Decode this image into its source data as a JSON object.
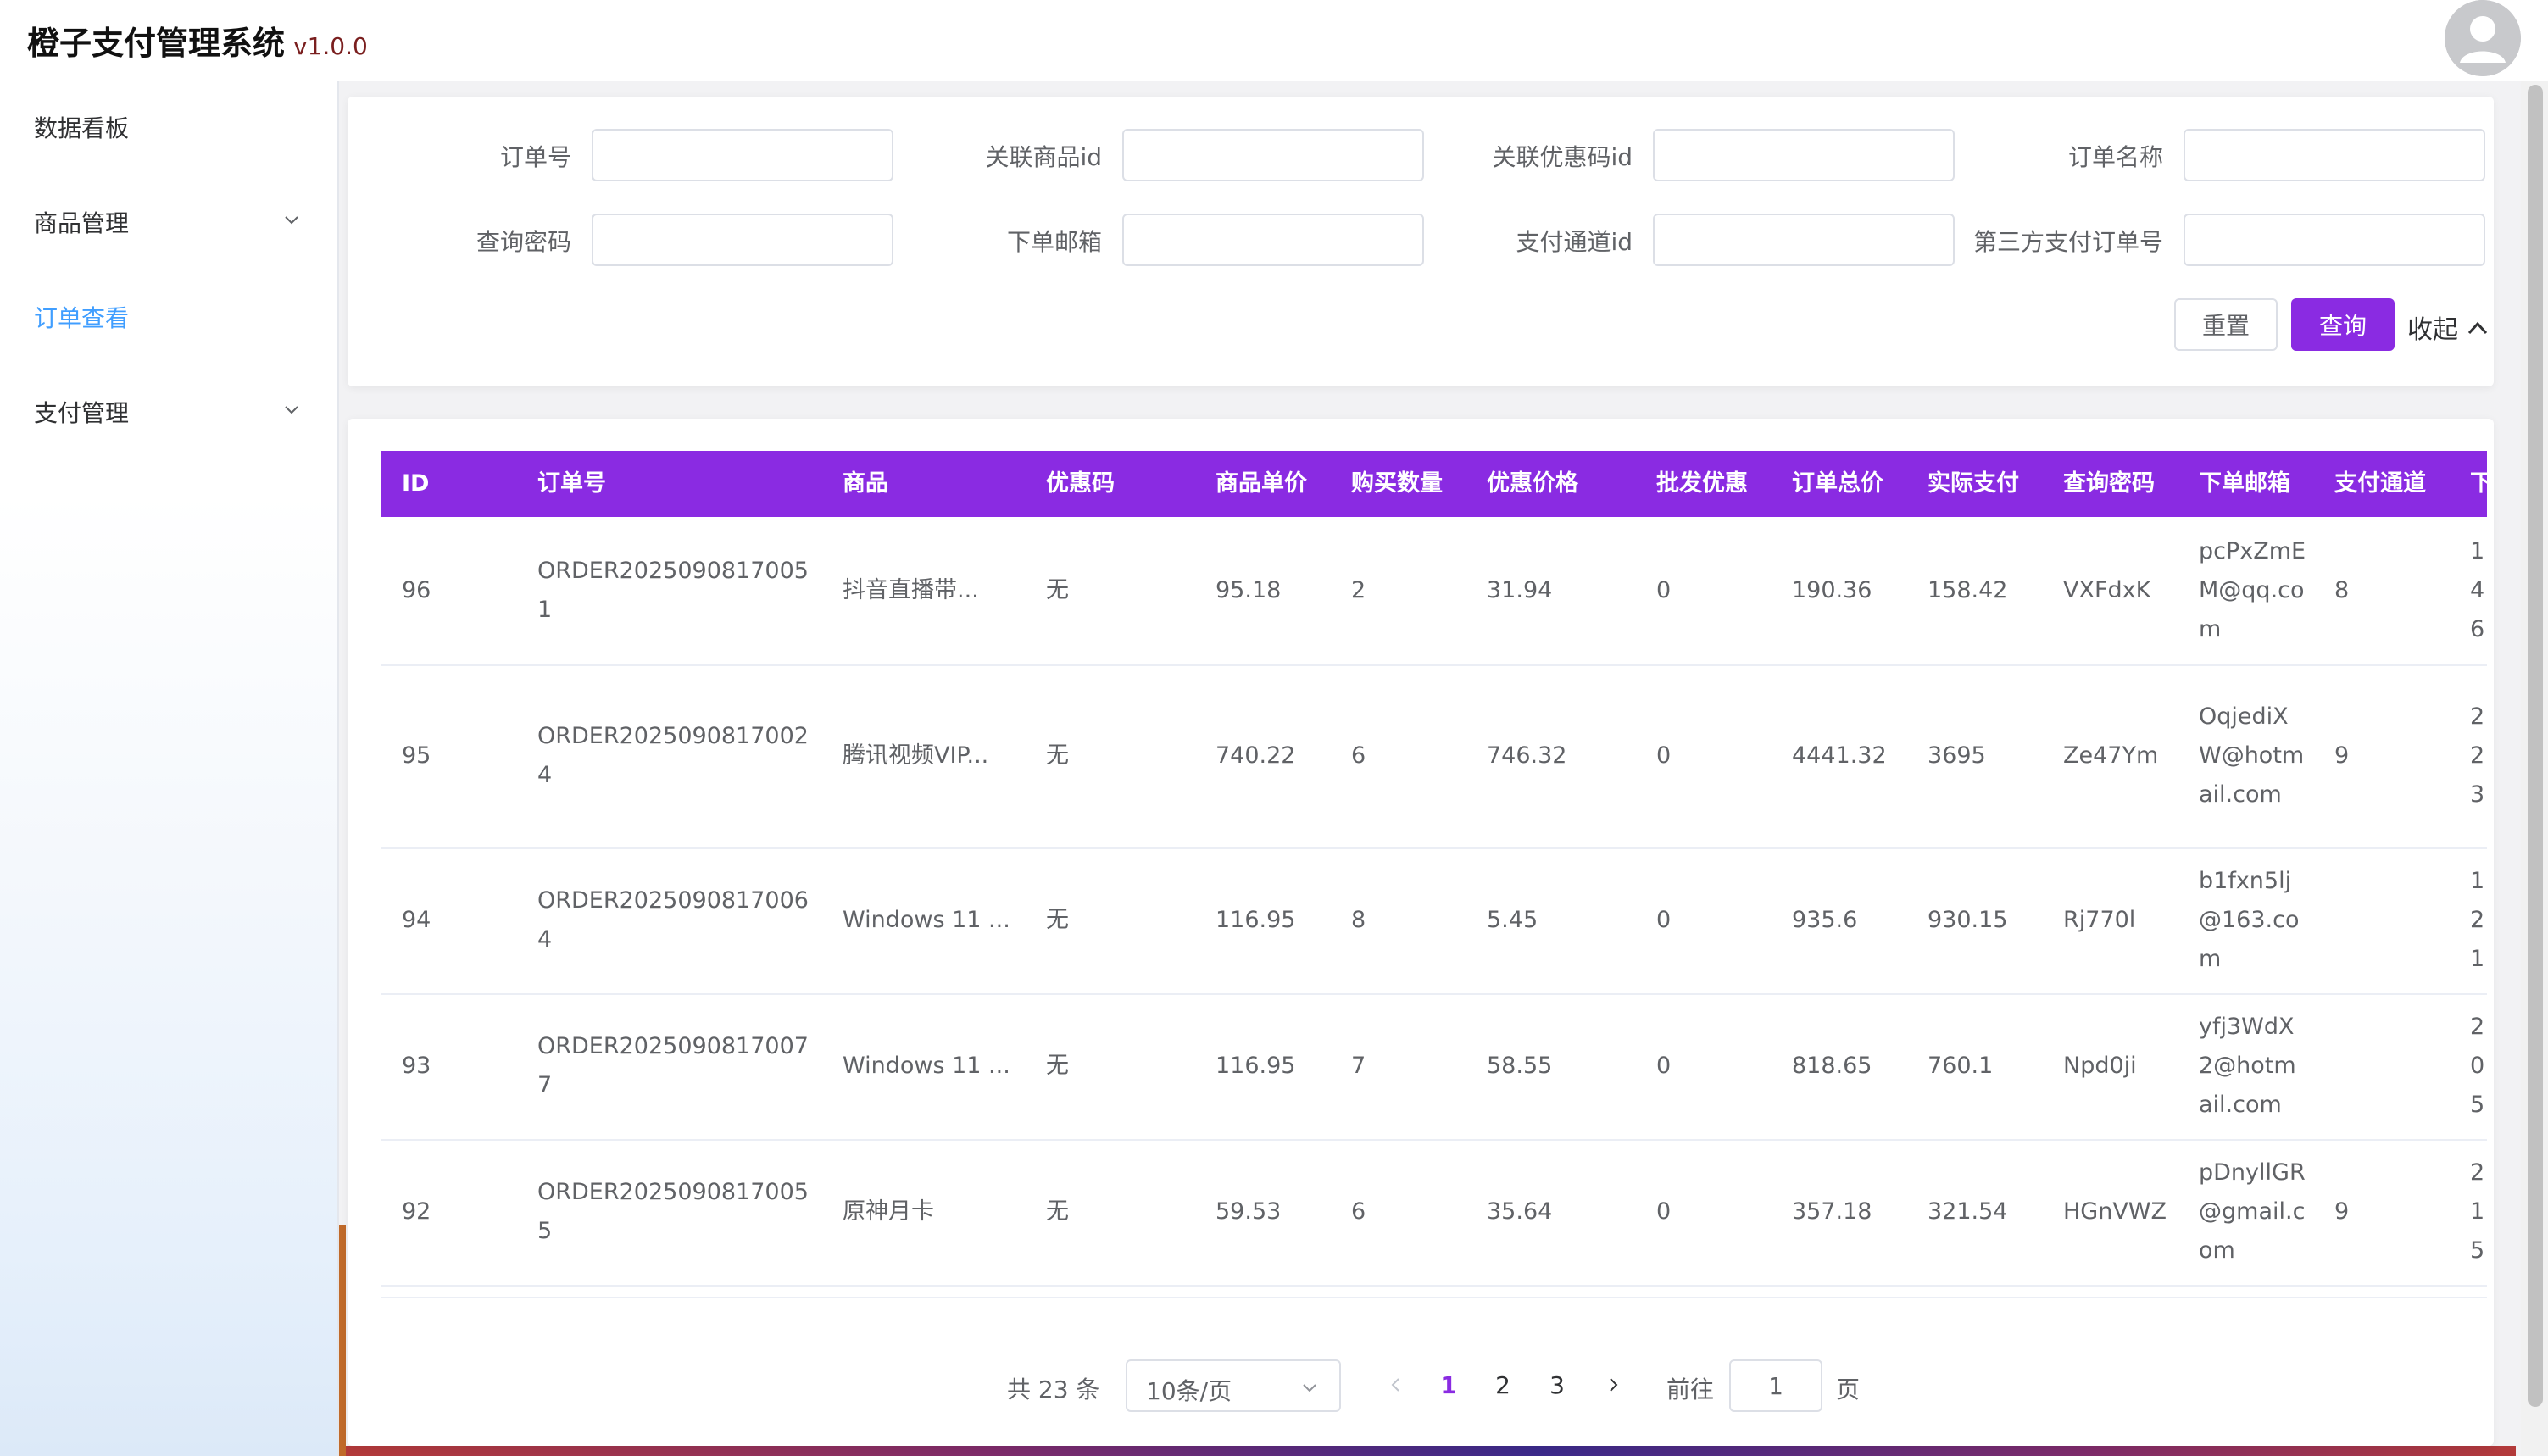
{
  "app": {
    "title": "橙子支付管理系统",
    "version": "v1.0.0"
  },
  "sidebar": {
    "items": [
      {
        "label": "数据看板",
        "has_children": false,
        "active": false
      },
      {
        "label": "商品管理",
        "has_children": true,
        "active": false
      },
      {
        "label": "订单查看",
        "has_children": false,
        "active": true
      },
      {
        "label": "支付管理",
        "has_children": true,
        "active": false
      }
    ]
  },
  "search": {
    "fields": [
      {
        "label": "订单号",
        "value": ""
      },
      {
        "label": "关联商品id",
        "value": ""
      },
      {
        "label": "关联优惠码id",
        "value": ""
      },
      {
        "label": "订单名称",
        "value": ""
      },
      {
        "label": "查询密码",
        "value": ""
      },
      {
        "label": "下单邮箱",
        "value": ""
      },
      {
        "label": "支付通道id",
        "value": ""
      },
      {
        "label": "第三方支付订单号",
        "value": ""
      }
    ],
    "reset_label": "重置",
    "query_label": "查询",
    "collapse_label": "收起"
  },
  "table": {
    "columns": [
      "ID",
      "订单号",
      "商品",
      "优惠码",
      "商品单价",
      "购买数量",
      "优惠价格",
      "批发优惠",
      "订单总价",
      "实际支付",
      "查询密码",
      "下单邮箱",
      "支付通道",
      "下"
    ],
    "rows": [
      {
        "id": "96",
        "order_no": "ORDER20250908170051",
        "product": "抖音直播带...",
        "coupon": "无",
        "unit_price": "95.18",
        "quantity": "2",
        "discount": "31.94",
        "bulk": "0",
        "total": "190.36",
        "paid": "158.42",
        "password": "VXFdxK",
        "email": "pcPxZmEM@qq.com",
        "channel": "8",
        "clipped": "146"
      },
      {
        "id": "95",
        "order_no": "ORDER20250908170024",
        "product": "腾讯视频VIP...",
        "coupon": "无",
        "unit_price": "740.22",
        "quantity": "6",
        "discount": "746.32",
        "bulk": "0",
        "total": "4441.32",
        "paid": "3695",
        "password": "Ze47Ym",
        "email": "OqjediXW@hotmail.com",
        "channel": "9",
        "clipped": "223"
      },
      {
        "id": "94",
        "order_no": "ORDER20250908170064",
        "product": "Windows 11 ...",
        "coupon": "无",
        "unit_price": "116.95",
        "quantity": "8",
        "discount": "5.45",
        "bulk": "0",
        "total": "935.6",
        "paid": "930.15",
        "password": "Rj770l",
        "email": "b1fxn5lj@163.com",
        "channel": "",
        "clipped": "121."
      },
      {
        "id": "93",
        "order_no": "ORDER20250908170077",
        "product": "Windows 11 ...",
        "coupon": "无",
        "unit_price": "116.95",
        "quantity": "7",
        "discount": "58.55",
        "bulk": "0",
        "total": "818.65",
        "paid": "760.1",
        "password": "Npd0ji",
        "email": "yfj3WdX2@hotmail.com",
        "channel": "",
        "clipped": "205"
      },
      {
        "id": "92",
        "order_no": "ORDER20250908170055",
        "product": "原神月卡",
        "coupon": "无",
        "unit_price": "59.53",
        "quantity": "6",
        "discount": "35.64",
        "bulk": "0",
        "total": "357.18",
        "paid": "321.54",
        "password": "HGnVWZ",
        "email": "pDnyllGR@gmail.com",
        "channel": "9",
        "clipped": "215"
      }
    ]
  },
  "pagination": {
    "total_text": "共 23 条",
    "page_size": "10条/页",
    "pages": [
      "1",
      "2",
      "3"
    ],
    "current_page": "1",
    "goto_label": "前往",
    "goto_value": "1",
    "page_suffix": "页"
  },
  "colors": {
    "accent": "#8a2be2",
    "active_menu": "#409eff"
  }
}
